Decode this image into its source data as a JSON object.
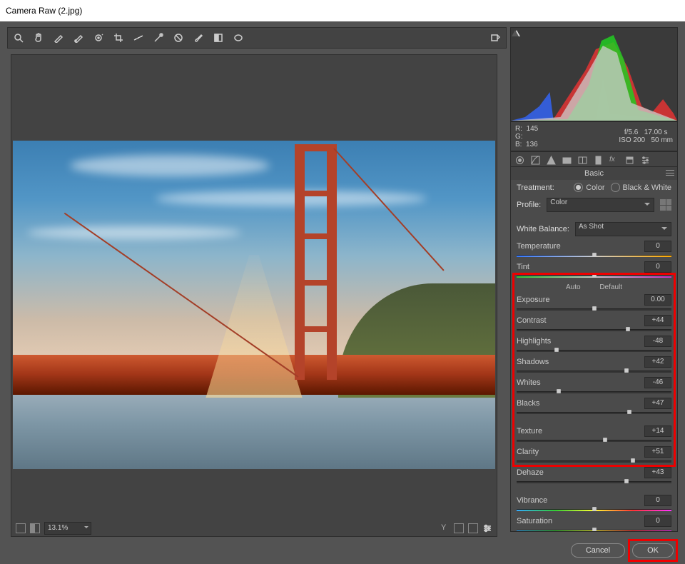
{
  "title": "Camera Raw (2.jpg)",
  "zoom": "13.1%",
  "rgb": {
    "r_label": "R:",
    "r": "145",
    "g_label": "G:",
    "g": "",
    "b_label": "B:",
    "b": "136"
  },
  "exif": {
    "aperture": "f/5.6",
    "shutter": "17.00 s",
    "iso": "ISO 200",
    "focal": "50 mm"
  },
  "panel_title": "Basic",
  "treatment": {
    "label": "Treatment:",
    "color": "Color",
    "bw": "Black & White"
  },
  "profile": {
    "label": "Profile:",
    "value": "Color"
  },
  "wb": {
    "label": "White Balance:",
    "value": "As Shot"
  },
  "auto": "Auto",
  "default": "Default",
  "sliders": {
    "temperature": {
      "label": "Temperature",
      "value": "0",
      "pos": 50,
      "cls": "temp"
    },
    "tint": {
      "label": "Tint",
      "value": "0",
      "pos": 50,
      "cls": "tint"
    },
    "exposure": {
      "label": "Exposure",
      "value": "0.00",
      "pos": 50
    },
    "contrast": {
      "label": "Contrast",
      "value": "+44",
      "pos": 72
    },
    "highlights": {
      "label": "Highlights",
      "value": "-48",
      "pos": 26
    },
    "shadows": {
      "label": "Shadows",
      "value": "+42",
      "pos": 71
    },
    "whites": {
      "label": "Whites",
      "value": "-46",
      "pos": 27
    },
    "blacks": {
      "label": "Blacks",
      "value": "+47",
      "pos": 73
    },
    "texture": {
      "label": "Texture",
      "value": "+14",
      "pos": 57
    },
    "clarity": {
      "label": "Clarity",
      "value": "+51",
      "pos": 75
    },
    "dehaze": {
      "label": "Dehaze",
      "value": "+43",
      "pos": 71
    },
    "vibrance": {
      "label": "Vibrance",
      "value": "0",
      "pos": 50,
      "cls": "rainbow"
    },
    "saturation": {
      "label": "Saturation",
      "value": "0",
      "pos": 50,
      "cls": "rainbow"
    }
  },
  "buttons": {
    "cancel": "Cancel",
    "ok": "OK"
  }
}
